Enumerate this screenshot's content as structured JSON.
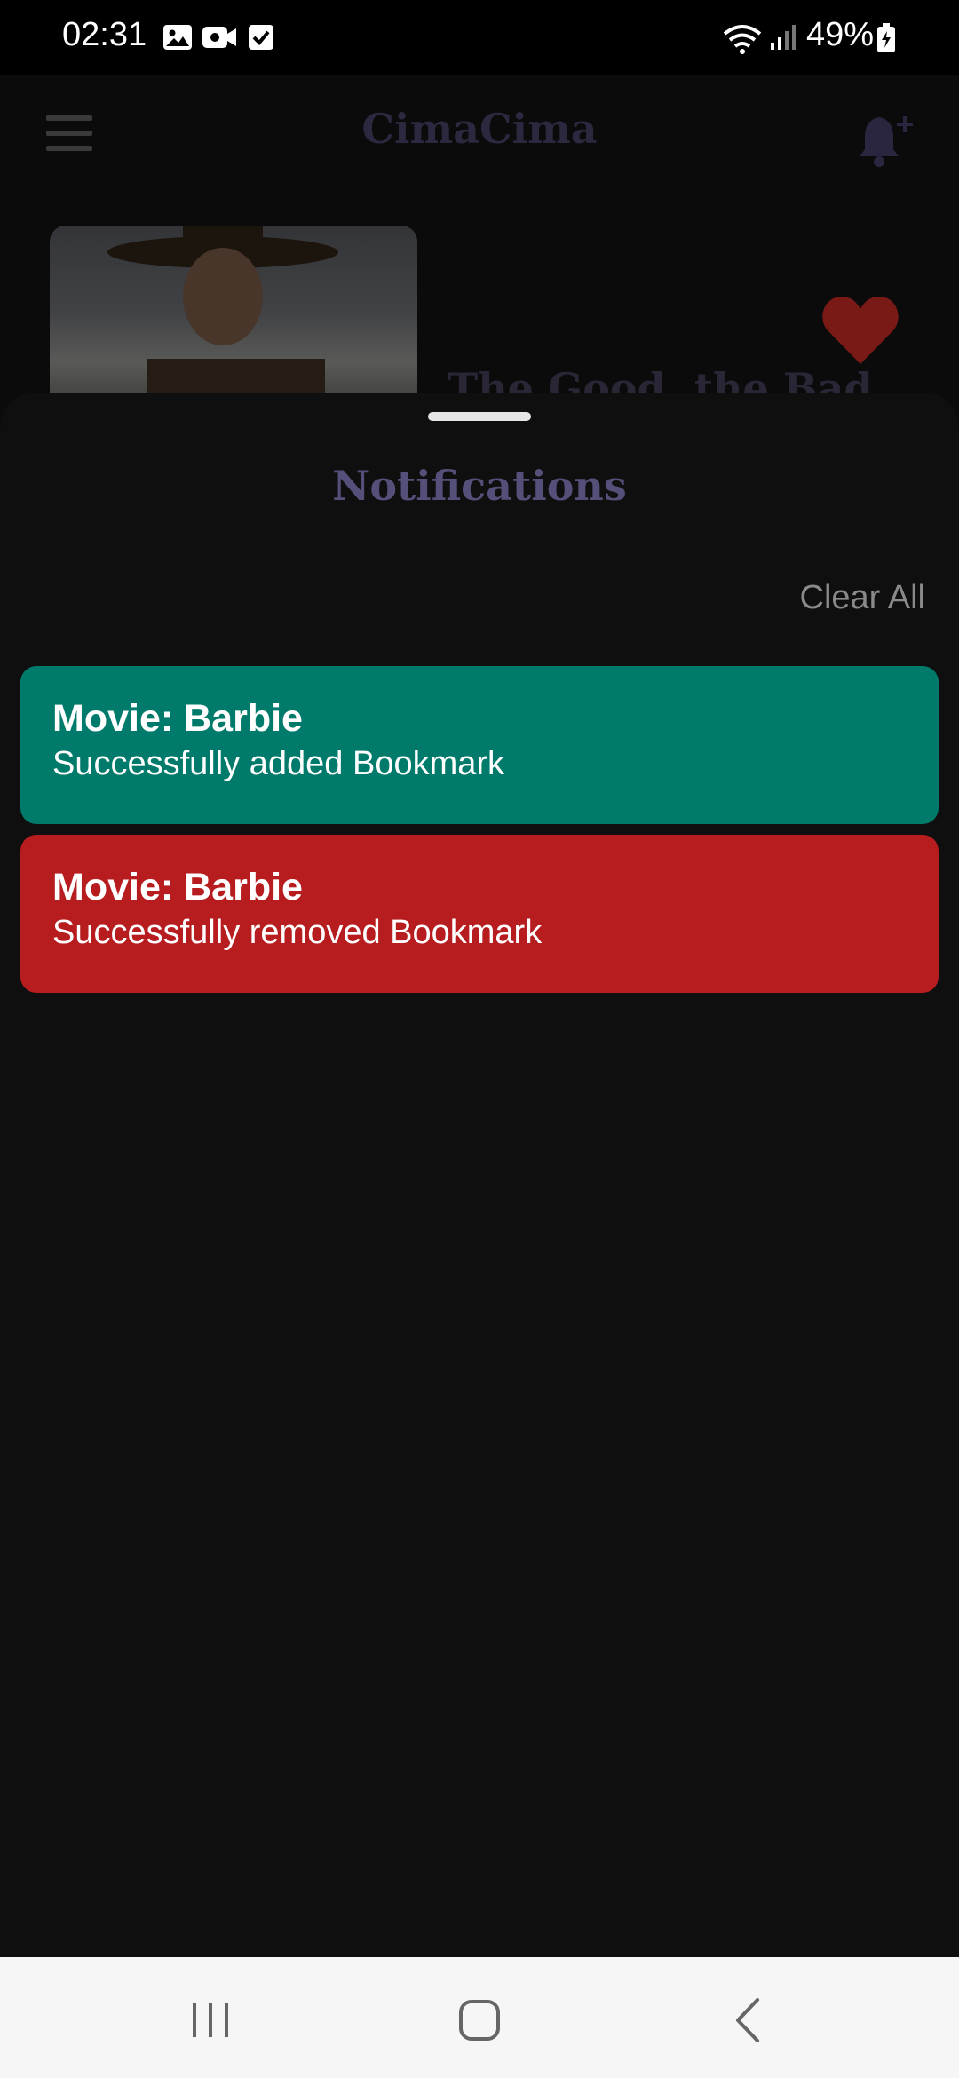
{
  "status_bar": {
    "time": "02:31",
    "battery": "49%",
    "icons": [
      "gallery-icon",
      "video-icon",
      "checkbox-icon",
      "wifi-icon",
      "signal-icon",
      "battery-icon"
    ]
  },
  "app": {
    "title": "CimaCima",
    "movie_title": "The Good, the Bad",
    "icons": [
      "menu-icon",
      "bell-plus-icon",
      "heart-icon"
    ],
    "heart_color": "#c0271f"
  },
  "sheet": {
    "title": "Notifications",
    "clear_all": "Clear All",
    "notifications": [
      {
        "title": "Movie: Barbie",
        "message": "Successfully added Bookmark",
        "color": "#007a6a"
      },
      {
        "title": "Movie: Barbie",
        "message": "Successfully removed Bookmark",
        "color": "#b71c1f"
      }
    ]
  },
  "nav": {
    "icons": [
      "recents-icon",
      "home-icon",
      "back-icon"
    ]
  }
}
